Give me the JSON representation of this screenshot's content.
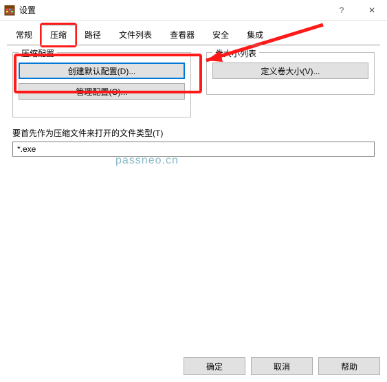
{
  "window": {
    "title": "设置",
    "help_glyph": "?",
    "close_glyph": "✕"
  },
  "tabs": {
    "items": [
      {
        "label": "常规"
      },
      {
        "label": "压缩"
      },
      {
        "label": "路径"
      },
      {
        "label": "文件列表"
      },
      {
        "label": "查看器"
      },
      {
        "label": "安全"
      },
      {
        "label": "集成"
      }
    ],
    "active_index": 1
  },
  "groups": {
    "compress": {
      "title": "压缩配置",
      "btn_create": "创建默认配置(D)...",
      "btn_manage": "管理配置(O)..."
    },
    "volume": {
      "title": "卷大小列表",
      "btn_define": "定义卷大小(V)..."
    }
  },
  "filetype": {
    "label": "要首先作为压缩文件来打开的文件类型(T)",
    "value": "*.exe"
  },
  "footer": {
    "ok": "确定",
    "cancel": "取消",
    "help": "帮助"
  },
  "watermark": "passneo.cn"
}
